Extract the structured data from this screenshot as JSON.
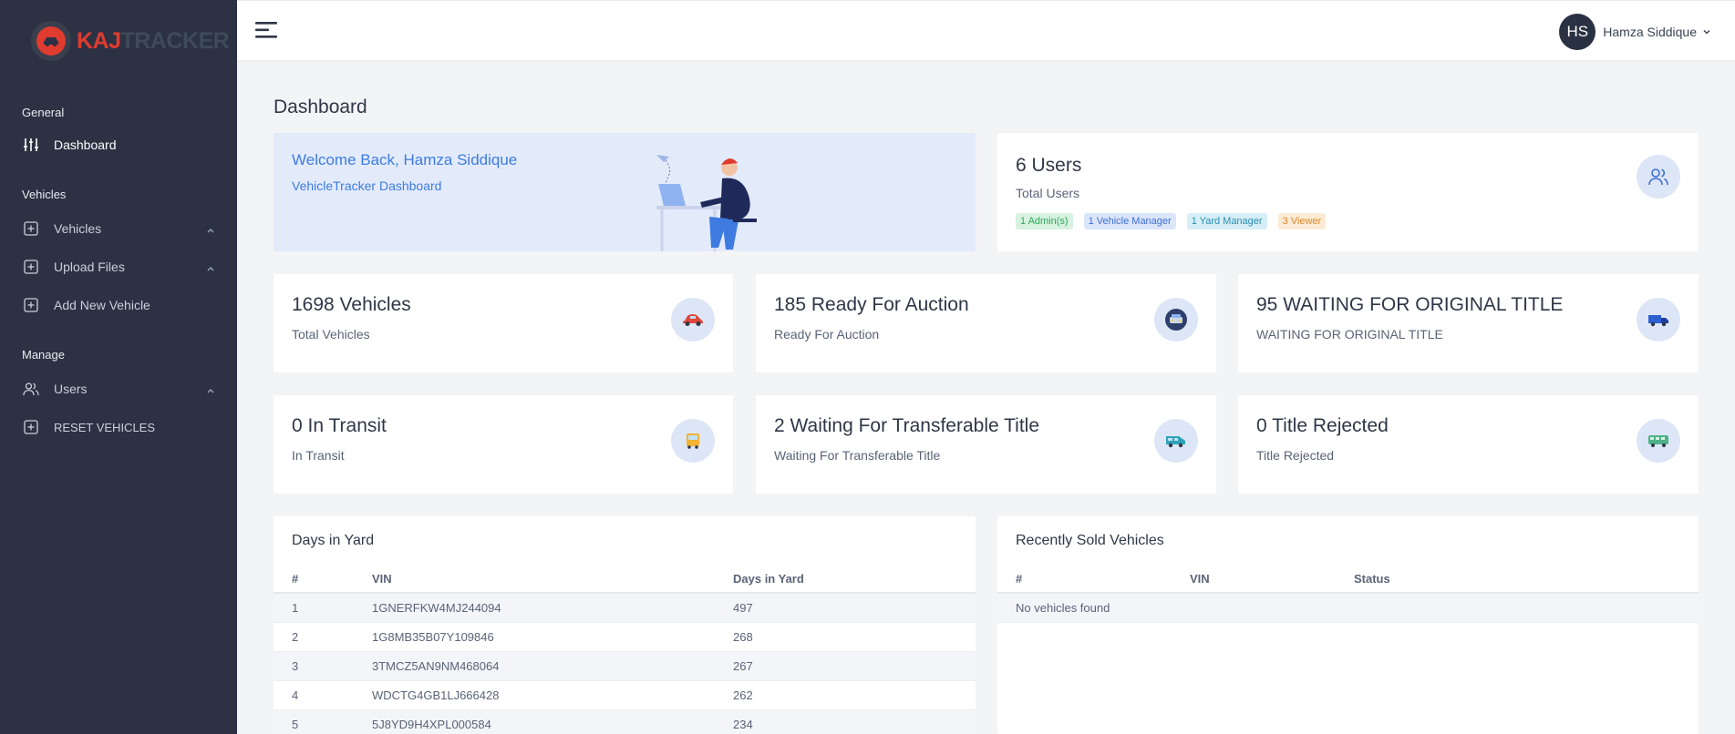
{
  "app": {
    "logo_part1": "KAJ",
    "logo_part2": "TRACKER",
    "brand_color": "#e03b2f"
  },
  "sidebar": {
    "sections": [
      "General",
      "Vehicles",
      "Manage"
    ],
    "items": [
      {
        "label": "Dashboard",
        "icon": "sliders-icon",
        "active": true
      },
      {
        "label": "Vehicles",
        "icon": "plus-square-icon",
        "has_submenu": true
      },
      {
        "label": "Upload Files",
        "icon": "plus-square-icon",
        "has_submenu": true
      },
      {
        "label": "Add New Vehicle",
        "icon": "plus-square-icon"
      },
      {
        "label": "Users",
        "icon": "users-icon",
        "has_submenu": true
      },
      {
        "label": "RESET VEHICLES",
        "icon": "plus-square-icon"
      }
    ]
  },
  "topbar": {
    "user_initials": "HS",
    "user_name": "Hamza Siddique"
  },
  "page": {
    "title": "Dashboard"
  },
  "welcome": {
    "title": "Welcome Back, Hamza Siddique",
    "subtitle": "VehicleTracker Dashboard"
  },
  "users_card": {
    "title": "6 Users",
    "subtitle": "Total Users",
    "badges": [
      {
        "label": "1 Admin(s)",
        "color": "#2fa95a",
        "bg": "#d7f2e0"
      },
      {
        "label": "1 Vehicle Manager",
        "color": "#3e6fd6",
        "bg": "#dbe5fa"
      },
      {
        "label": "1 Yard Manager",
        "color": "#2a8fb3",
        "bg": "#d6eef6"
      },
      {
        "label": "3 Viewer",
        "color": "#e08a2c",
        "bg": "#fbebd6"
      }
    ]
  },
  "stats": [
    {
      "title": "1698 Vehicles",
      "subtitle": "Total Vehicles",
      "icon": "car-icon"
    },
    {
      "title": "185 Ready For Auction",
      "subtitle": "Ready For Auction",
      "icon": "car-front-icon"
    },
    {
      "title": "95 WAITING FOR ORIGINAL TITLE",
      "subtitle": "WAITING FOR ORIGINAL TITLE",
      "icon": "truck-icon"
    },
    {
      "title": "0 In Transit",
      "subtitle": "In Transit",
      "icon": "bus-icon"
    },
    {
      "title": "2 Waiting For Transferable Title",
      "subtitle": "Waiting For Transferable Title",
      "icon": "van-icon"
    },
    {
      "title": "0 Title Rejected",
      "subtitle": "Title Rejected",
      "icon": "minibus-icon"
    }
  ],
  "days_in_yard": {
    "title": "Days in Yard",
    "columns": [
      "#",
      "VIN",
      "Days in Yard"
    ],
    "rows": [
      [
        "1",
        "1GNERFKW4MJ244094",
        "497"
      ],
      [
        "2",
        "1G8MB35B07Y109846",
        "268"
      ],
      [
        "3",
        "3TMCZ5AN9NM468064",
        "267"
      ],
      [
        "4",
        "WDCTG4GB1LJ666428",
        "262"
      ],
      [
        "5",
        "5J8YD9H4XPL000584",
        "234"
      ]
    ]
  },
  "recently_sold": {
    "title": "Recently Sold Vehicles",
    "columns": [
      "#",
      "VIN",
      "Status"
    ],
    "empty_text": "No vehicles found"
  }
}
